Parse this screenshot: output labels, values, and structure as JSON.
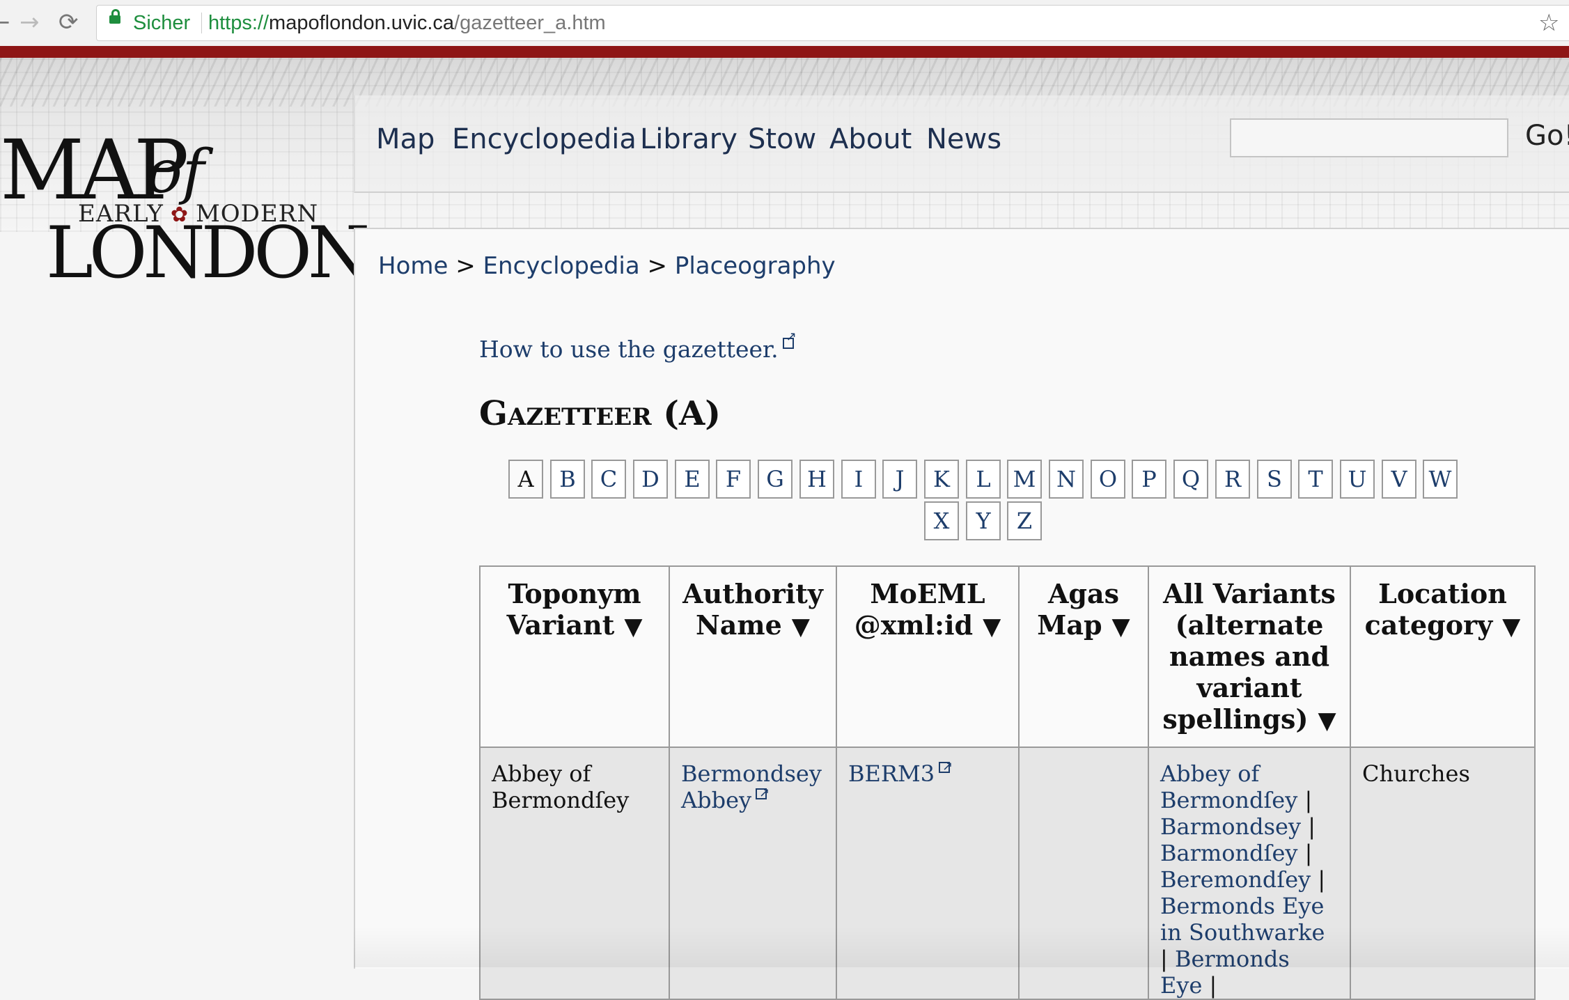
{
  "browser": {
    "secure_label": "Sicher",
    "url_scheme": "https://",
    "url_host": "mapoflondon.uvic.ca",
    "url_path": "/gazetteer_a.htm"
  },
  "logo": {
    "line1": "MAP",
    "line1_of": "of",
    "line2_left": "EARLY",
    "line2_right": "MODERN",
    "line3": "LONDON"
  },
  "nav": {
    "items": [
      "Map",
      "Encyclopedia",
      "Library",
      "Stow",
      "About",
      "News"
    ],
    "search_placeholder": "",
    "go_label": "Go!"
  },
  "breadcrumb": {
    "items": [
      "Home",
      "Encyclopedia",
      "Placeography"
    ],
    "separator": ">"
  },
  "howto_link": "How to use the gazetteer.",
  "page_title": "Gazetteer (A)",
  "letters": [
    "A",
    "B",
    "C",
    "D",
    "E",
    "F",
    "G",
    "H",
    "I",
    "J",
    "K",
    "L",
    "M",
    "N",
    "O",
    "P",
    "Q",
    "R",
    "S",
    "T",
    "U",
    "V",
    "W",
    "X",
    "Y",
    "Z"
  ],
  "active_letter": "A",
  "table": {
    "headers": [
      {
        "label": "Toponym Variant",
        "sort": "▼"
      },
      {
        "label": "Authority Name",
        "sort": "▼"
      },
      {
        "label": "MoEML @xml:id",
        "sort": "▼"
      },
      {
        "label": "Agas Map",
        "sort": "▼"
      },
      {
        "label": "All Variants (alternate names and variant spellings)",
        "sort": "▼"
      },
      {
        "label": "Location category",
        "sort": "▼"
      }
    ],
    "rows": [
      {
        "toponym": "Abbey of Bermondſey",
        "authority": "Bermondsey Abbey",
        "xml_id": "BERM3",
        "agas": "",
        "variants": [
          "Abbey of Bermondſey",
          "Barmondsey",
          "Barmondſey",
          "Beremondſey",
          "Bermonds Eye in Southwarke",
          "Bermonds Eye"
        ],
        "category": "Churches"
      }
    ]
  },
  "colors": {
    "link": "#1d3d6b",
    "accent_bar": "#8e1616",
    "secure": "#1e8e3e"
  }
}
